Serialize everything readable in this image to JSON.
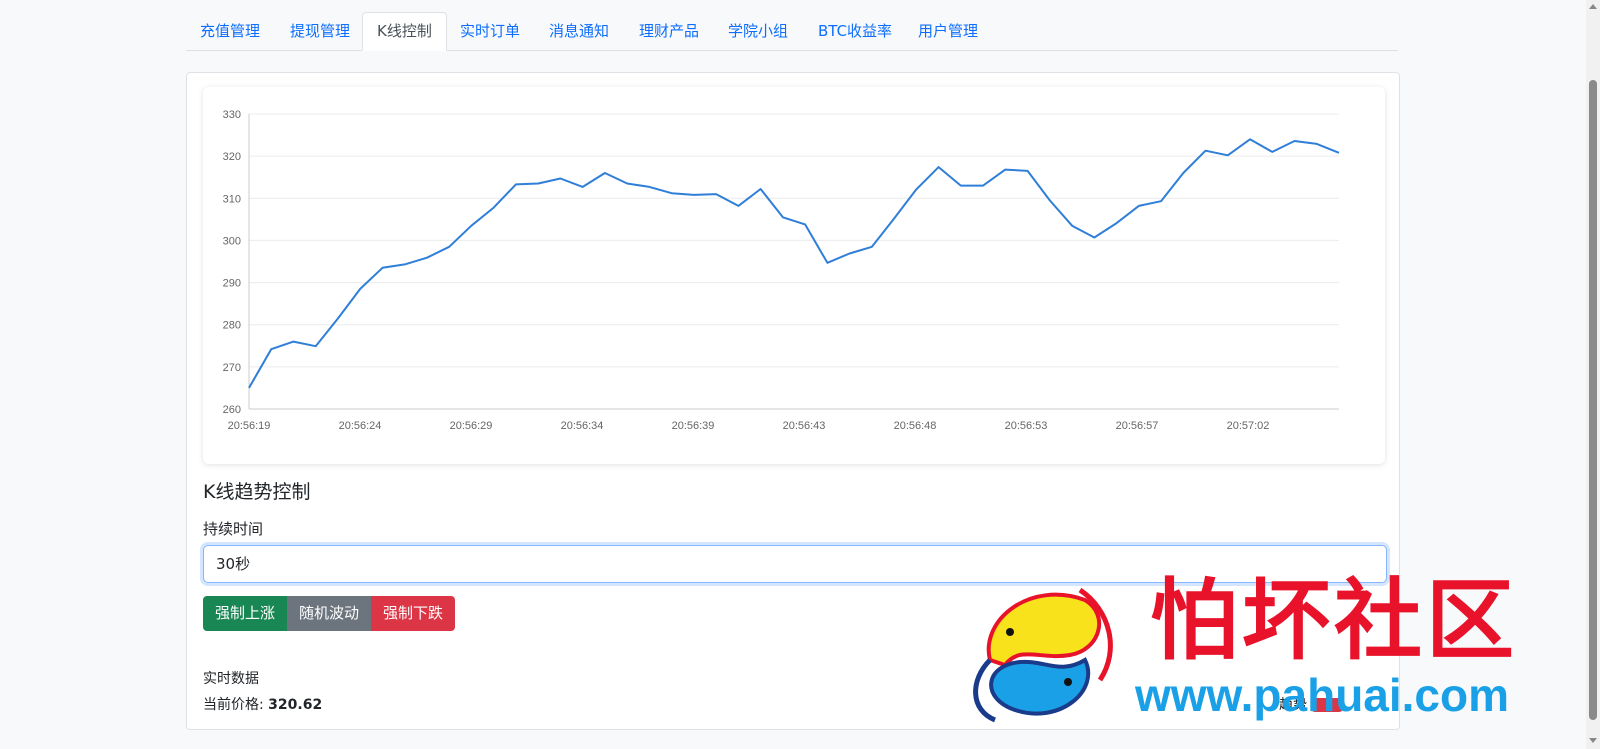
{
  "tabs": [
    {
      "label": "充值管理",
      "active": false
    },
    {
      "label": "提现管理",
      "active": false
    },
    {
      "label": "K线控制",
      "active": true
    },
    {
      "label": "实时订单",
      "active": false
    },
    {
      "label": "消息通知",
      "active": false
    },
    {
      "label": "理财产品",
      "active": false
    },
    {
      "label": "学院小组",
      "active": false
    },
    {
      "label": "BTC收益率",
      "active": false
    },
    {
      "label": "用户管理",
      "active": false
    }
  ],
  "chart_data": {
    "type": "line",
    "title": "",
    "xlabel": "",
    "ylabel": "",
    "ylim": [
      260,
      330
    ],
    "yticks": [
      260,
      270,
      280,
      290,
      300,
      310,
      320,
      330
    ],
    "xtick_labels": [
      "20:56:19",
      "20:56:24",
      "20:56:29",
      "20:56:34",
      "20:56:39",
      "20:56:43",
      "20:56:48",
      "20:56:53",
      "20:56:57",
      "20:57:02"
    ],
    "grid": true,
    "legend": "none",
    "line_color": "#2f7ed8",
    "values": [
      265,
      274.2,
      276,
      274.9,
      281.5,
      288.5,
      293.5,
      294.3,
      295.9,
      298.5,
      303.5,
      307.8,
      313.3,
      313.5,
      314.7,
      312.7,
      316,
      313.5,
      312.7,
      311.2,
      310.8,
      311,
      308.2,
      312.2,
      305.5,
      303.8,
      294.7,
      296.9,
      298.5,
      305.2,
      312.1,
      317.4,
      313,
      313,
      316.8,
      316.5,
      309.5,
      303.5,
      300.7,
      304.1,
      308.2,
      309.3,
      316,
      321.3,
      320.2,
      324,
      321,
      323.6,
      322.9,
      320.8
    ]
  },
  "control": {
    "title": "K线趋势控制",
    "duration_label": "持续时间",
    "duration_value": "30秒",
    "btn_up": "强制上涨",
    "btn_random": "随机波动",
    "btn_down": "强制下跌"
  },
  "realtime": {
    "title": "实时数据",
    "price_label": "当前价格:",
    "price_value": "320.62",
    "trend_label": "趋势"
  },
  "watermark": {
    "title": "怕坏社区",
    "url": "www.pahuai.com"
  }
}
